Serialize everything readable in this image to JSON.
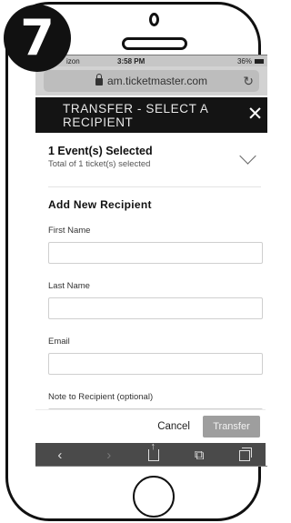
{
  "step": {
    "number": "7"
  },
  "status_bar": {
    "carrier": "izon",
    "time": "3:58 PM",
    "battery": "36%"
  },
  "url_bar": {
    "url": "am.ticketmaster.com"
  },
  "header": {
    "title": "TRANSFER - SELECT A RECIPIENT"
  },
  "event_section": {
    "title": "1 Event(s) Selected",
    "subtitle": "Total of 1 ticket(s) selected"
  },
  "recipient_form": {
    "section_title": "Add New Recipient",
    "fields": [
      {
        "label": "First Name",
        "value": ""
      },
      {
        "label": "Last Name",
        "value": ""
      },
      {
        "label": "Email",
        "value": ""
      },
      {
        "label": "Note to Recipient (optional)",
        "value": ""
      }
    ]
  },
  "actions": {
    "cancel_label": "Cancel",
    "transfer_label": "Transfer"
  },
  "toolbar": {
    "icons": [
      "back-icon",
      "forward-icon",
      "share-icon",
      "bookmarks-icon",
      "tabs-icon"
    ],
    "back_glyph": "‹",
    "forward_glyph": "›",
    "bookmarks_glyph": "⧉"
  },
  "colors": {
    "header_bg": "#141414",
    "transfer_disabled": "#9e9e9e",
    "toolbar_bg": "#4a4a4a"
  }
}
